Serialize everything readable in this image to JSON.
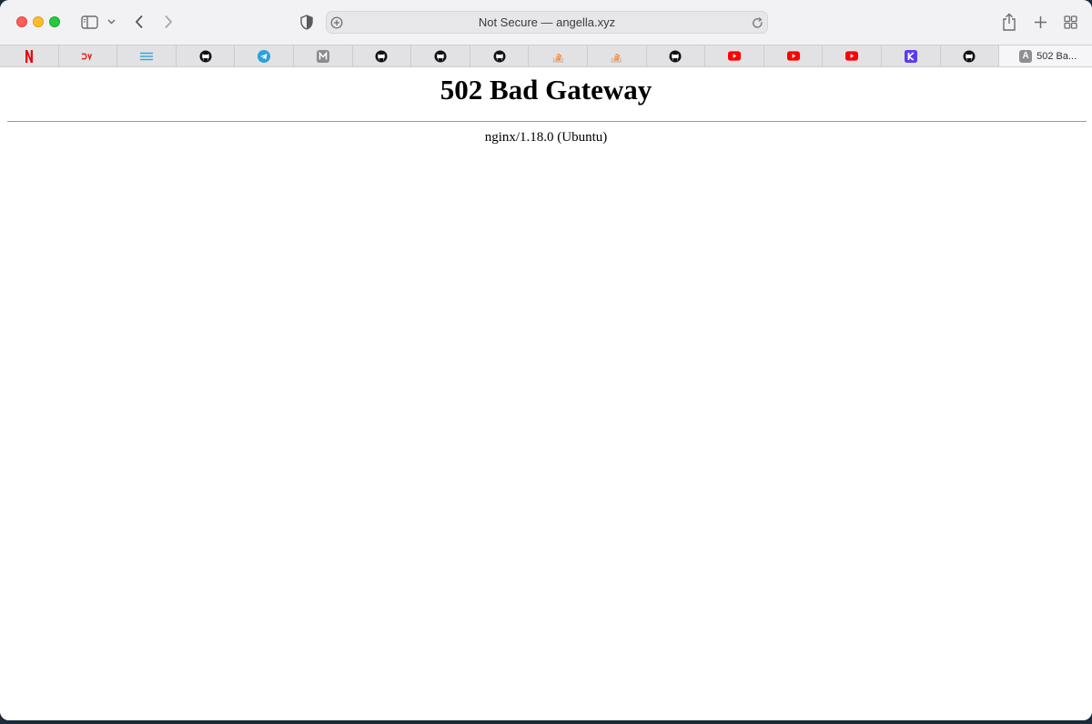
{
  "window": {
    "address_bar": {
      "text": "Not Secure — angella.xyz"
    }
  },
  "tabs": [
    {
      "icon": "netflix-icon",
      "color": "#e50914"
    },
    {
      "icon": "dev-icon",
      "color": "#e02020"
    },
    {
      "icon": "menu-lines-icon",
      "color": "#2aa7d8"
    },
    {
      "icon": "github-icon",
      "color": "#111111"
    },
    {
      "icon": "telegram-icon",
      "color": "#2aa1da"
    },
    {
      "icon": "m-icon",
      "color": "#8a8a8f"
    },
    {
      "icon": "github-icon",
      "color": "#111111"
    },
    {
      "icon": "github-icon",
      "color": "#111111"
    },
    {
      "icon": "github-icon",
      "color": "#111111"
    },
    {
      "icon": "stackoverflow-icon",
      "color": "#f48024"
    },
    {
      "icon": "stackoverflow-icon",
      "color": "#f48024"
    },
    {
      "icon": "github-icon",
      "color": "#111111"
    },
    {
      "icon": "youtube-icon",
      "color": "#ff0000"
    },
    {
      "icon": "youtube-icon",
      "color": "#ff0000"
    },
    {
      "icon": "youtube-icon",
      "color": "#ff0000"
    },
    {
      "icon": "k-icon",
      "color": "#5b3df0"
    },
    {
      "icon": "github-icon",
      "color": "#111111"
    }
  ],
  "active_tab": {
    "badge": "A",
    "title": "502 Ba..."
  },
  "page": {
    "heading": "502 Bad Gateway",
    "server": "nginx/1.18.0 (Ubuntu)"
  }
}
